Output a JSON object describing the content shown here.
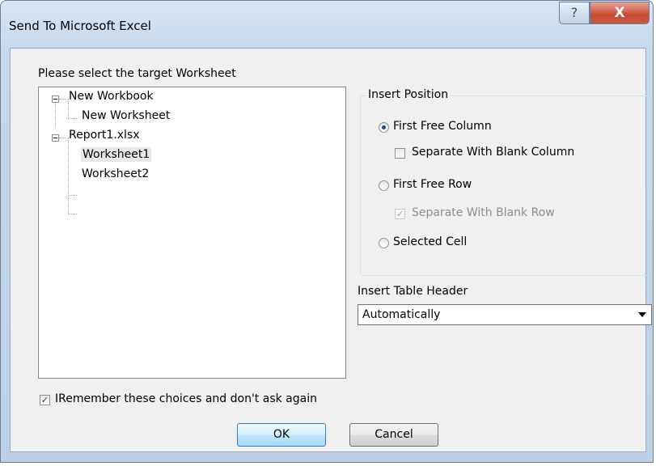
{
  "window": {
    "title": "Send To Microsoft Excel",
    "help_glyph": "?",
    "close_glyph": "X"
  },
  "tree": {
    "label": "Please select the target Worksheet",
    "workbook1": "New Workbook",
    "worksheet_new": "New Worksheet",
    "workbook2": "Report1.xlsx",
    "sheet1": "Worksheet1",
    "sheet2": "Worksheet2"
  },
  "insert_position": {
    "title": "Insert Position",
    "first_free_column": "First Free Column",
    "sep_blank_column": "Separate With Blank Column",
    "first_free_row": "First Free Row",
    "sep_blank_row": "Separate With Blank Row",
    "selected_cell": "Selected Cell"
  },
  "header": {
    "label": "Insert Table Header",
    "value": "Automatically"
  },
  "remember": {
    "label": "IRemember these choices and don't ask again",
    "check": "✓"
  },
  "buttons": {
    "ok": "OK",
    "cancel": "Cancel"
  }
}
